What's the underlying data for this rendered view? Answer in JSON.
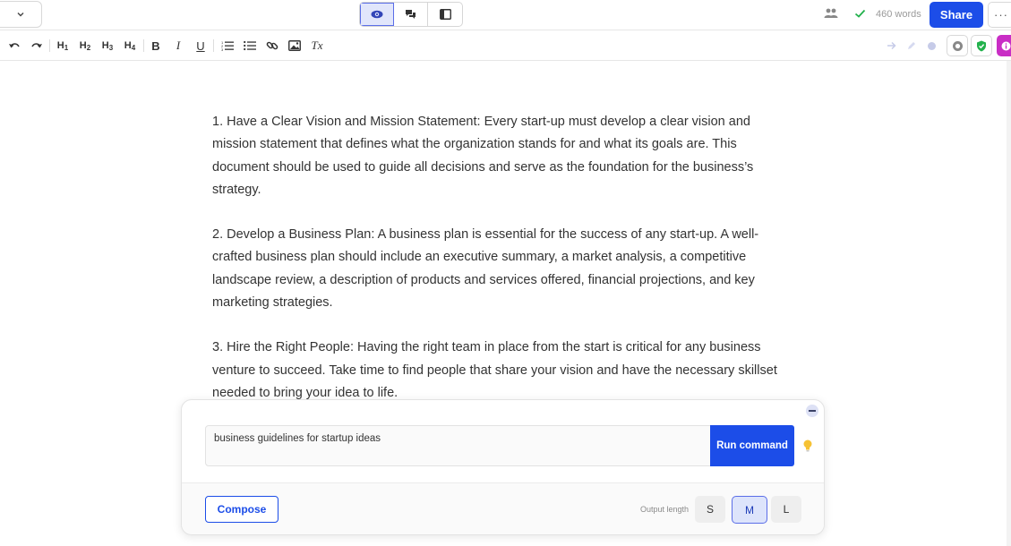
{
  "topbar": {
    "dropdown_icon": "chevron-down-icon",
    "views": [
      {
        "icon": "eye-icon",
        "active": true
      },
      {
        "icon": "comments-icon",
        "active": false
      },
      {
        "icon": "sidebar-panel-icon",
        "active": false
      }
    ],
    "collaborators_icon": "users-icon",
    "saved_icon": "check-icon",
    "word_count": "460 words",
    "share_label": "Share",
    "more_label": "···"
  },
  "toolbar": {
    "undo_icon": "undo-icon",
    "redo_icon": "redo-icon",
    "headings": [
      {
        "letter": "H",
        "num": "1"
      },
      {
        "letter": "H",
        "num": "2"
      },
      {
        "letter": "H",
        "num": "3"
      },
      {
        "letter": "H",
        "num": "4"
      }
    ],
    "bold": "B",
    "italic": "I",
    "underline": "U",
    "clear_format": "Tx"
  },
  "document": {
    "paragraphs": [
      "1. Have a Clear Vision and Mission Statement: Every start-up must develop a clear vision and mission statement that defines what the organization stands for and what its goals are. This document should be used to guide all decisions and serve as the foundation for the business’s strategy.",
      "2. Develop a Business Plan: A business plan is essential for the success of any start-up. A well-crafted business plan should include an executive summary, a market analysis, a competitive landscape review, a description of products and services offered, financial projections, and key marketing strategies.",
      "3. Hire the Right People: Having the right team in place from the start is critical for any business venture to succeed. Take time to find people that share your vision and have the necessary skillset needed to bring your idea to life."
    ]
  },
  "ai_panel": {
    "prompt_value": "business guidelines for startup ideas",
    "run_label": "Run command",
    "compose_label": "Compose",
    "output_length_label": "Output length",
    "sizes": [
      {
        "label": "S",
        "active": false
      },
      {
        "label": "M",
        "active": true
      },
      {
        "label": "L",
        "active": false
      }
    ]
  },
  "colors": {
    "accent": "#1c4de8",
    "active_bg": "#e1e6fb",
    "purple": "#c92ec5",
    "green": "#22b14c"
  }
}
